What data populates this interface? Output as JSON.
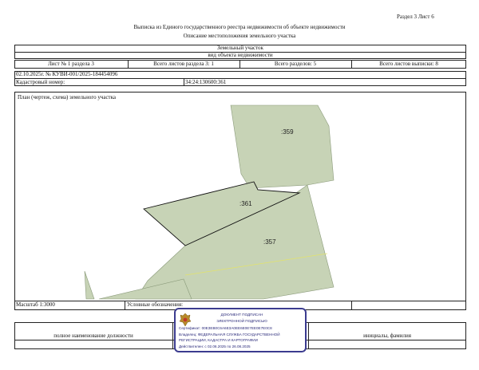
{
  "header": {
    "section_sheet": "Раздел 3   Лист 6",
    "title": "Выписка из Единого государственного реестра недвижимости об объекте недвижимости",
    "subtitle": "Описание местоположения земельного участка"
  },
  "object": {
    "type": "Земельный участок",
    "type_caption": "вид объекта недвижимости"
  },
  "meta_row": {
    "sheet_section": "Лист № 1 раздела 3",
    "total_sheets_section": "Всего листов раздела 3: 1",
    "total_sections": "Всего разделов: 5",
    "total_sheets_extract": "Всего листов выписки: 8"
  },
  "extract": {
    "number": "02.10.2025г. № КУВИ-001/2025-184454096",
    "cadastral_label": "Кадастровый номер:",
    "cadastral_value": "34:24:130600:361"
  },
  "plan": {
    "title": "План (чертеж, схема) земельного участка",
    "parcels": [
      ":359",
      ":361",
      ":357"
    ],
    "colors": {
      "parcel_fill": "#c7d3b6",
      "parcel_stroke": "#8a9a7a",
      "boundary": "#111111",
      "edge_yellow": "#e3e36a"
    }
  },
  "scale_row": {
    "scale": "Масштаб 1:3000",
    "legend_label": "Условные обозначения:"
  },
  "footer": {
    "position_label": "полное наименование должности",
    "name_label": "инициалы, фамилия"
  },
  "stamp": {
    "line1": "ДОКУМЕНТ ПОДПИСАН",
    "line2": "ЭЛЕКТРОННОЙ ПОДПИСЬЮ",
    "line3": "Сертификат: 00ЕЗЕВ0С6А6ЕЗА0ЕЕ6Е0Е7ЕЕ0Е7Е0С8",
    "line4": "Владелец: ФЕДЕРАЛЬНАЯ СЛУЖБА ГОСУДАРСТВЕННОЙ",
    "line5": "РЕГИСТРАЦИИ, КАДАСТРА И КАРТОГРАФИИ",
    "line6": "Действителен: с 02.06.2025 по 26.08.2025",
    "color": "#3b3b8f"
  }
}
